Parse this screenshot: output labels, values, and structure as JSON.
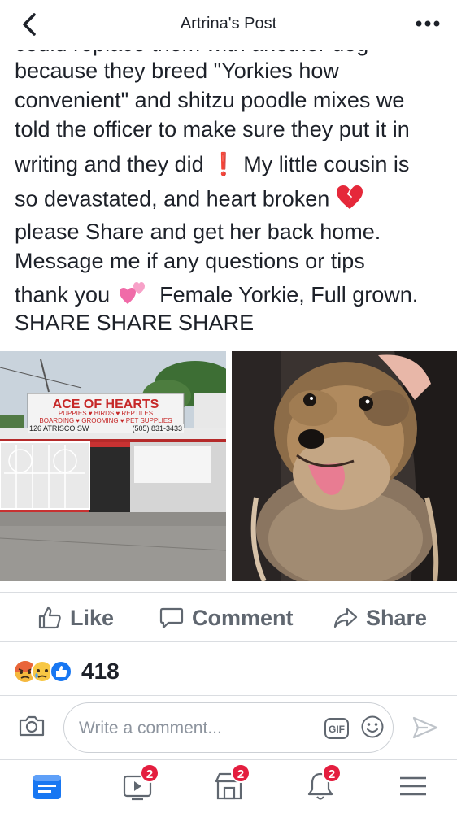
{
  "header": {
    "title": "Artrina's Post"
  },
  "post": {
    "cut_line": "could replace them with another dog",
    "lines": [
      "because they breed \"Yorkies how",
      "convenient\" and shitzu poodle mixes we",
      "told the officer to make sure they put it in",
      "writing and they did",
      "My little cousin is",
      "so devastated, and heart broken",
      "please Share and get her back home.",
      "Message me if any questions or tips",
      "thank you",
      "Female Yorkie, Full grown.",
      "SHARE SHARE SHARE"
    ],
    "exclamation": "❗"
  },
  "store_sign": {
    "name": "ACE OF HEARTS",
    "services_1": "PUPPIES ♥ BIRDS ♥ REPTILES",
    "services_2": "BOARDING ♥ GROOMING ♥ PET SUPPLIES",
    "address": "126 ATRISCO SW",
    "phone": "(505) 831-3433"
  },
  "actions": {
    "like": "Like",
    "comment": "Comment",
    "share": "Share"
  },
  "reactions": {
    "count": "418",
    "types": [
      "angry",
      "sad",
      "like"
    ]
  },
  "composer": {
    "placeholder": "Write a comment...",
    "gif_label": "GIF"
  },
  "nav": {
    "watch_badge": "2",
    "marketplace_badge": "2",
    "notifications_badge": "2"
  },
  "colors": {
    "accent": "#1877f2",
    "badge": "#e41e3f",
    "text": "#1d2129",
    "muted": "#606770"
  }
}
